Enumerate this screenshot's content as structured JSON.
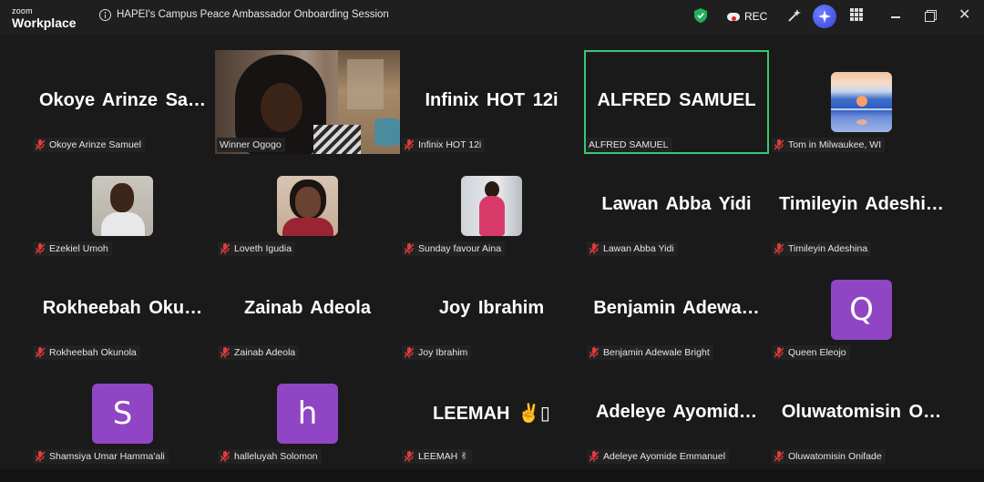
{
  "app": {
    "brand_small": "zoom",
    "brand_big": "Workplace",
    "session_title": "HAPEI's Campus Peace Ambassador Onboarding Session"
  },
  "toolbar": {
    "rec_label": "REC"
  },
  "colors": {
    "active_speaker": "#37c972",
    "letter_tile": "#8f45c4",
    "mute_icon": "#e23b3b"
  },
  "participants": [
    {
      "display": "Okoye Arinze Sa…",
      "label": "Okoye Arinze Samuel"
    },
    {
      "display": "",
      "label": "Winner Ogogo"
    },
    {
      "display": "Infinix HOT 12i",
      "label": "Infinix HOT 12i"
    },
    {
      "display": "ALFRED SAMUEL",
      "label": "ALFRED SAMUEL"
    },
    {
      "display": "",
      "label": "Tom in Milwaukee, WI"
    },
    {
      "display": "",
      "label": "Ezekiel Umoh"
    },
    {
      "display": "",
      "label": "Loveth Igudia"
    },
    {
      "display": "",
      "label": "Sunday favour Aina"
    },
    {
      "display": "Lawan Abba Yidi",
      "label": "Lawan Abba Yidi"
    },
    {
      "display": "Timileyin  Adeshi…",
      "label": "Timileyin Adeshina"
    },
    {
      "display": "Rokheebah  Oku…",
      "label": "Rokheebah Okunola"
    },
    {
      "display": "Zainab Adeola",
      "label": "Zainab Adeola"
    },
    {
      "display": "Joy Ibrahim",
      "label": "Joy Ibrahim"
    },
    {
      "display": "Benjamin  Adewa…",
      "label": "Benjamin Adewale Bright"
    },
    {
      "display": "Q",
      "label": "Queen Eleojo"
    },
    {
      "display": "S",
      "label": "Shamsiya Umar Hamma'ali"
    },
    {
      "display": "h",
      "label": "halleluyah Solomon"
    },
    {
      "display": "LEEMAH ✌️▯",
      "label": "LEEMAH ✌"
    },
    {
      "display": "Adeleye  Ayomid…",
      "label": "Adeleye Ayomide Emmanuel"
    },
    {
      "display": "Oluwatomisin  O…",
      "label": "Oluwatomisin Onifade"
    }
  ]
}
